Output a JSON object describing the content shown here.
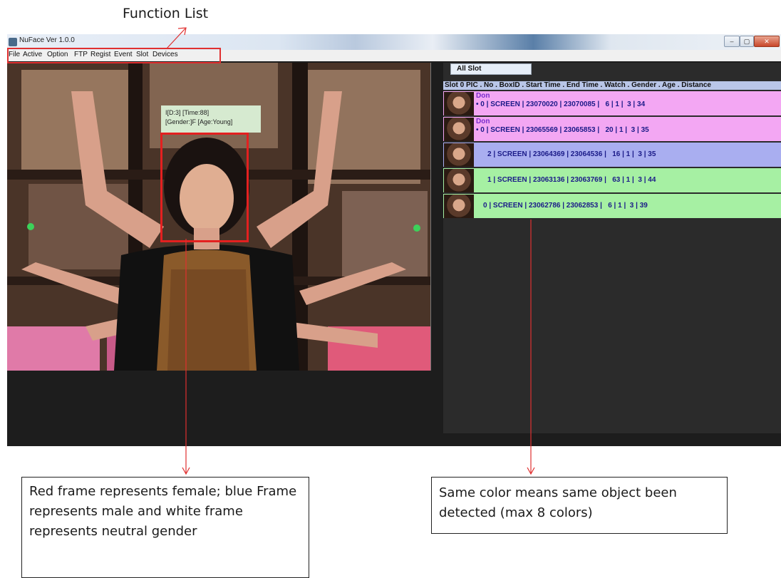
{
  "annotations": {
    "function_list": "Function List",
    "gender_note": "Red frame represents female; blue Frame represents male and white frame represents neutral gender",
    "color_note": "Same color means same object been detected (max 8 colors)"
  },
  "window": {
    "title": "NuFace Ver 1.0.0",
    "buttons": [
      "–",
      "▢",
      "✕"
    ]
  },
  "menu": [
    "File",
    "Active",
    "Option",
    "FTP",
    "Regist",
    "Event",
    "Slot",
    "Devices"
  ],
  "detection": {
    "line1": "I[D:3]  [Time:88]",
    "line2": "[Gender:]F  [Age:Young]",
    "frame_color": "#e32020"
  },
  "panel": {
    "tab": "All Slot",
    "header": "Slot 0 PIC . No . BoxID .  Start Time . End Time . Watch . Gender . Age . Distance",
    "rows": [
      {
        "name": "Don",
        "info": "• 0 | SCREEN | 23070020 | 23070085 |   6 | 1 |  3 | 34",
        "color": "#f3a7f3"
      },
      {
        "name": "Don",
        "info": "• 0 | SCREEN | 23065569 | 23065853 |   20 | 1 |  3 | 35",
        "color": "#f3a7f3"
      },
      {
        "name": "",
        "info": "2 | SCREEN | 23064369 | 23064536 |   16 | 1 |  3 | 35",
        "color": "#a9aef0"
      },
      {
        "name": "",
        "info": "1 | SCREEN | 23063136 | 23063769 |   63 | 1 |  3 | 44",
        "color": "#a6f0a3"
      },
      {
        "name": "",
        "info": "0 | SCREEN | 23062786 | 23062853 |   6 | 1 |  3 | 39",
        "color": "#a6f0a3"
      }
    ]
  },
  "colors": {
    "female_frame": "#e32020",
    "annotation_red": "#e03030"
  }
}
